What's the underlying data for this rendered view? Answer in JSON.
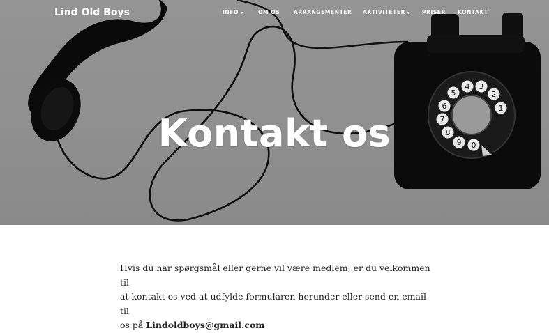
{
  "brand": "Lind Old Boys",
  "nav": {
    "info": "INFO",
    "om_os": "OM OS",
    "arrangementer": "ARRANGEMENTER",
    "aktiviteter": "AKTIVITETER",
    "priser": "PRISER",
    "kontakt": "KONTAKT"
  },
  "hero": {
    "title": "Kontakt os"
  },
  "content": {
    "line1": "Hvis du har spørgsmål eller gerne vil være medlem, er du velkommen til",
    "line2": "at kontakt os ved at udfylde formularen herunder eller send en email til",
    "line3_prefix": "os på ",
    "email": "Lindoldboys@gmail.com"
  },
  "icons": {
    "dropdown": "caret-down-icon"
  },
  "colors": {
    "hero_bg": "#919191",
    "text": "#222222",
    "nav_text": "#ffffff"
  }
}
